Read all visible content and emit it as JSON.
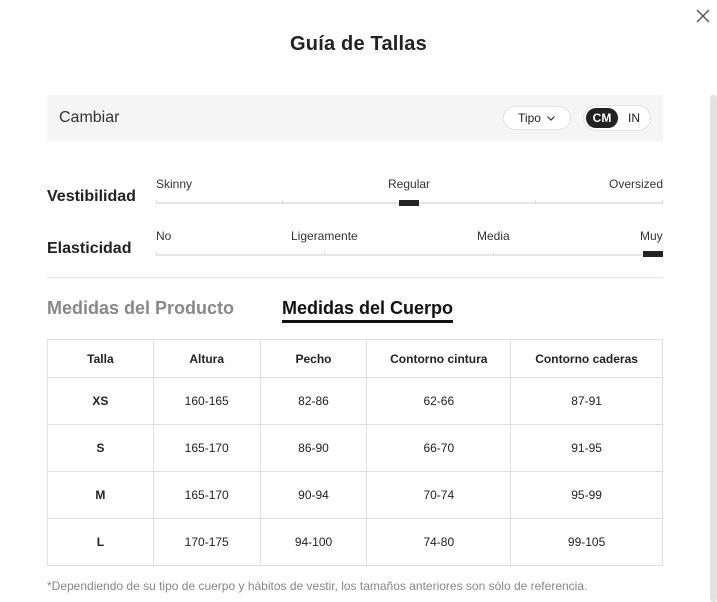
{
  "modal": {
    "title": "Guía de Tallas"
  },
  "icons": {
    "close": "close-icon",
    "chevron": "chevron-down-icon"
  },
  "toolbar": {
    "label": "Cambiar",
    "type_select": "Tipo",
    "units": [
      "CM",
      "IN"
    ],
    "selected_unit": "CM"
  },
  "fit": {
    "label": "Vestibilidad",
    "options": [
      "Skinny",
      "Regular",
      "Oversized"
    ],
    "selected": "Regular"
  },
  "stretch": {
    "label": "Elasticidad",
    "options": [
      "No",
      "Ligeramente",
      "Media",
      "Muy"
    ],
    "selected": "Muy"
  },
  "tabs": {
    "product": "Medidas del Producto",
    "body": "Medidas del Cuerpo",
    "active": "body"
  },
  "table": {
    "headers": [
      "Talla",
      "Altura",
      "Pecho",
      "Contorno cintura",
      "Contorno caderas"
    ],
    "rows": [
      [
        "XS",
        "160-165",
        "82-86",
        "62-66",
        "87-91"
      ],
      [
        "S",
        "165-170",
        "86-90",
        "66-70",
        "91-95"
      ],
      [
        "M",
        "165-170",
        "90-94",
        "70-74",
        "95-99"
      ],
      [
        "L",
        "170-175",
        "94-100",
        "74-80",
        "99-105"
      ]
    ]
  },
  "footnote": "*Dependiendo de su tipo de cuerpo y hábitos de vestir, los tamaños anteriores son sólo de referencia.",
  "colors": {
    "accent": "#222222",
    "muted": "#888888",
    "bar_bg": "#f5f5f5"
  }
}
